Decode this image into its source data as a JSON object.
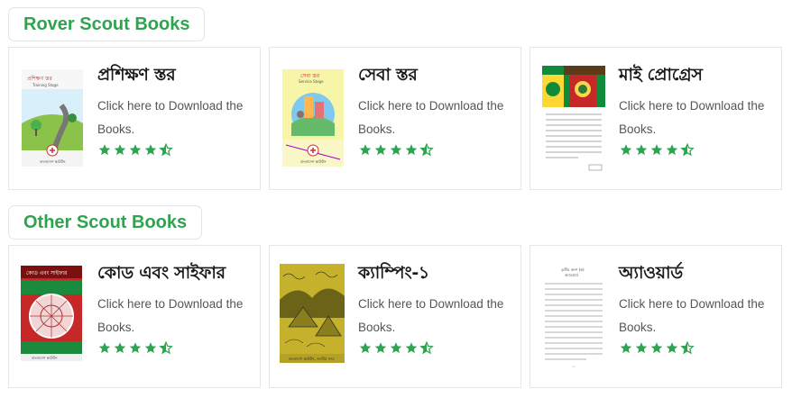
{
  "sections": [
    {
      "heading": "Rover Scout Books",
      "books": [
        {
          "title": "প্রশিক্ষণ স্তর",
          "description": "Click here to Download the Books.",
          "rating": 4.5,
          "cover_icon": "book-cover-training"
        },
        {
          "title": "সেবা স্তর",
          "description": "Click here to Download the Books.",
          "rating": 4.5,
          "cover_icon": "book-cover-service"
        },
        {
          "title": "মাই প্রোগ্রেস",
          "description": "Click here to Download the Books.",
          "rating": 4.5,
          "cover_icon": "book-cover-progress"
        }
      ]
    },
    {
      "heading": "Other Scout Books",
      "books": [
        {
          "title": "কোড এবং সাইফার",
          "description": "Click here to Download the Books.",
          "rating": 4.5,
          "cover_icon": "book-cover-code-cipher"
        },
        {
          "title": "ক্যাম্পিং-১",
          "description": "Click here to Download the Books.",
          "rating": 4.5,
          "cover_icon": "book-cover-camping"
        },
        {
          "title": "অ্যাওয়ার্ড",
          "description": "Click here to Download the Books.",
          "rating": 4.5,
          "cover_icon": "book-cover-award"
        }
      ]
    }
  ],
  "colors": {
    "accent": "#2ea44f",
    "star": "#2ea44f",
    "card_border": "#e6e6e6",
    "text_muted": "#555555"
  }
}
